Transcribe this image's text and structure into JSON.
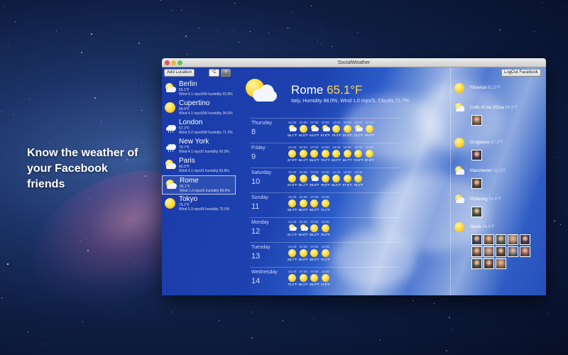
{
  "tagline": "Know the weather of your Facebook friends",
  "window": {
    "title": "SocialWeather"
  },
  "toolbar": {
    "add_location": "Add Location",
    "unit_c": "°C",
    "unit_f": "°F",
    "logout": "LogOut Facebook"
  },
  "locations": [
    {
      "name": "Berlin",
      "temp": "55.1°F",
      "details": "Wind 4.1 mps/SW humidity 63.8%",
      "icon": "partly-cloudy-icon"
    },
    {
      "name": "Cupertino",
      "temp": "68.9°F",
      "details": "Wind 4.1 mps/SW humidity 34.0%",
      "icon": "sun-icon"
    },
    {
      "name": "London",
      "temp": "57.3°F",
      "details": "Wind 9.2 mps/SW humidity 71.3%",
      "icon": "rain-icon"
    },
    {
      "name": "New York",
      "temp": "70.7°F",
      "details": "Wind 4.1 mps/S humidity 90.0%",
      "icon": "rain-icon"
    },
    {
      "name": "Paris",
      "temp": "60.2°F",
      "details": "Wind 4.1 mps/S humidity 65.8%",
      "icon": "partly-cloudy-icon"
    },
    {
      "name": "Rome",
      "temp": "65.1°F",
      "details": "Wind 1.0 mps/S humidity 88.0%",
      "icon": "partly-cloudy-icon"
    },
    {
      "name": "Tokyo",
      "temp": "75.2°F",
      "details": "Wind 0.3 mps/N humidity 75.0%",
      "icon": "sun-icon"
    }
  ],
  "current": {
    "city": "Rome",
    "temp": "65.1°F",
    "details": "Italy, Humidity 88.0%, Wind 1.0 mps/S, Clouds 72.7%"
  },
  "days": [
    {
      "name": "Thursday",
      "num": "8",
      "hours": [
        {
          "t": "01:00",
          "v": "65.1°F",
          "i": "partly"
        },
        {
          "t": "04:00",
          "v": "64.5°F",
          "i": "sun"
        },
        {
          "t": "07:00",
          "v": "64.5°F",
          "i": "partly"
        },
        {
          "t": "10:00",
          "v": "67.8°F",
          "i": "partly"
        },
        {
          "t": "13:00",
          "v": "79.3°F",
          "i": "sun"
        },
        {
          "t": "16:00",
          "v": "84.4°F",
          "i": "sun"
        },
        {
          "t": "19:00",
          "v": "74.1°F",
          "i": "partly"
        },
        {
          "t": "22:00",
          "v": "70.0°F",
          "i": "sun"
        }
      ]
    },
    {
      "name": "Friday",
      "num": "9",
      "hours": [
        {
          "t": "01:00",
          "v": "67.8°F",
          "i": "sun"
        },
        {
          "t": "04:00",
          "v": "65.1°F",
          "i": "sun"
        },
        {
          "t": "07:00",
          "v": "66.6°F",
          "i": "sun"
        },
        {
          "t": "10:00",
          "v": "79.2°F",
          "i": "sun"
        },
        {
          "t": "13:00",
          "v": "83.0°F",
          "i": "sun"
        },
        {
          "t": "16:00",
          "v": "84.7°F",
          "i": "sun"
        },
        {
          "t": "19:00",
          "v": "73.9°F",
          "i": "sun"
        },
        {
          "t": "22:00",
          "v": "67.8°F",
          "i": "sun"
        }
      ]
    },
    {
      "name": "Saturday",
      "num": "10",
      "hours": [
        {
          "t": "01:00",
          "v": "67.8°F",
          "i": "sun"
        },
        {
          "t": "04:00",
          "v": "65.1°F",
          "i": "sun"
        },
        {
          "t": "07:00",
          "v": "69.8°F",
          "i": "partly"
        },
        {
          "t": "10:00",
          "v": "79.0°F",
          "i": "sun"
        },
        {
          "t": "13:00",
          "v": "81.5°F",
          "i": "sun"
        },
        {
          "t": "16:00",
          "v": "87.8°F",
          "i": "sun"
        },
        {
          "t": "19:00",
          "v": "70.6°F",
          "i": "sun"
        }
      ]
    },
    {
      "name": "Sunday",
      "num": "11",
      "hours": [
        {
          "t": "01:00",
          "v": "69.4°F",
          "i": "sun"
        },
        {
          "t": "04:00",
          "v": "68.0°F",
          "i": "sun"
        },
        {
          "t": "07:00",
          "v": "80.2°F",
          "i": "sun"
        },
        {
          "t": "10:00",
          "v": "74.1°F",
          "i": "sun"
        }
      ]
    },
    {
      "name": "Monday",
      "num": "12",
      "hours": [
        {
          "t": "01:00",
          "v": "67.1°F",
          "i": "partly"
        },
        {
          "t": "04:00",
          "v": "69.8°F",
          "i": "partly"
        },
        {
          "t": "07:00",
          "v": "80.2°F",
          "i": "sun"
        },
        {
          "t": "10:00",
          "v": "76.2°F",
          "i": "sun"
        }
      ]
    },
    {
      "name": "Tuesday",
      "num": "13",
      "hours": [
        {
          "t": "01:00",
          "v": "69.7°F",
          "i": "sun"
        },
        {
          "t": "04:00",
          "v": "68.0°F",
          "i": "sun"
        },
        {
          "t": "07:00",
          "v": "80.2°F",
          "i": "sun"
        },
        {
          "t": "10:00",
          "v": "74.1°F",
          "i": "sun"
        }
      ]
    },
    {
      "name": "Wednesday",
      "num": "14",
      "hours": [
        {
          "t": "01:00",
          "v": "70.2°F",
          "i": "sun"
        },
        {
          "t": "07:00",
          "v": "68.1°F",
          "i": "sun"
        },
        {
          "t": "07:00",
          "v": "80.0°F",
          "i": "sun"
        },
        {
          "t": "10:00",
          "v": "74.9°F",
          "i": "sun"
        }
      ]
    }
  ],
  "friends": [
    {
      "city": "Florence",
      "temp": "61.5°F",
      "icon": "sun",
      "avatars": 0
    },
    {
      "city": "Colle di Val d'Elsa",
      "temp": "64.9°F",
      "icon": "partly",
      "avatars": 1
    },
    {
      "city": "Gruglasco",
      "temp": "67.3°F",
      "icon": "sun",
      "avatars": 1
    },
    {
      "city": "Manchester",
      "temp": "52.9°F",
      "icon": "partly",
      "avatars": 1
    },
    {
      "city": "Pickering",
      "temp": "54.8°F",
      "icon": "partly",
      "avatars": 1
    },
    {
      "city": "Siena",
      "temp": "64.4°F",
      "icon": "sun",
      "avatars": 13
    }
  ],
  "colors": {
    "window_bg": "#1c3a9e",
    "accent_temp": "#ffd84a"
  }
}
